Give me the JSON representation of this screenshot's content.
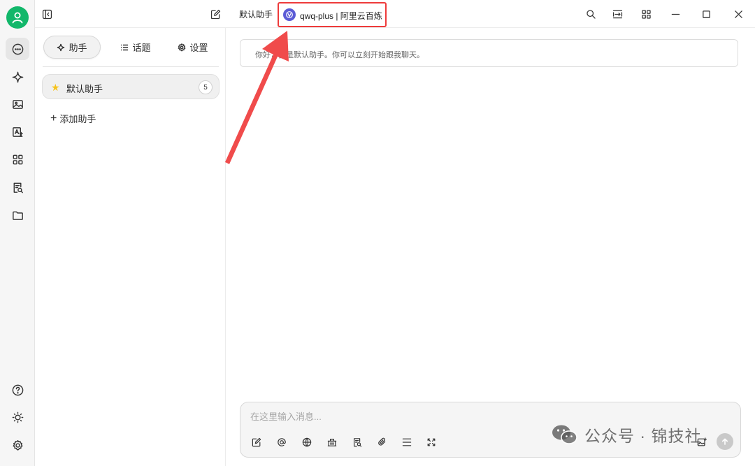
{
  "titlebar": {
    "assistant_name": "默认助手",
    "model_name": "qwq-plus | 阿里云百炼"
  },
  "tabs": [
    {
      "label": "助手",
      "icon": "sparkle-icon",
      "active": true
    },
    {
      "label": "话题",
      "icon": "list-icon",
      "active": false
    },
    {
      "label": "设置",
      "icon": "gear-icon",
      "active": false
    }
  ],
  "assistants": [
    {
      "name": "默认助手",
      "count": "5",
      "icon": "star-icon"
    }
  ],
  "add_assistant_label": "添加助手",
  "welcome_message": "你好，我是默认助手。你可以立刻开始跟我聊天。",
  "composer": {
    "placeholder": "在这里输入消息..."
  },
  "watermark": "公众号 · 锦技社",
  "colors": {
    "avatar": "#12b76a",
    "highlight": "#ee3b3b",
    "model_logo": "#5b5bd6",
    "star": "#f7c31a"
  }
}
